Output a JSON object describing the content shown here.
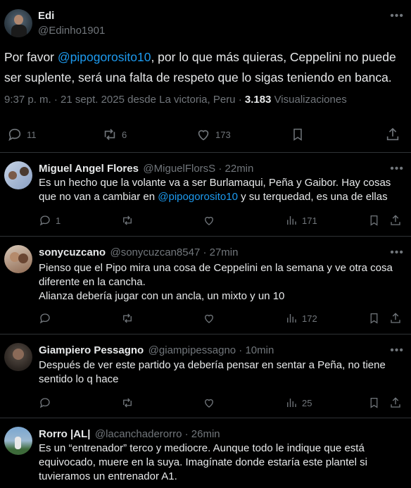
{
  "main": {
    "name": "Edi",
    "handle": "@Edinho1901",
    "text_pre": "Por favor ",
    "mention": "@pipogorosito10",
    "text_post": ", por lo que más quieras, Ceppelini no puede ser suplente, será una falta de respeto que lo sigas teniendo en banca.",
    "meta_time": "9:37 p. m. · 21 sept. 2025 desde La victoria, Peru · ",
    "views_count": "3.183",
    "views_label": " Visualizaciones",
    "replies": "11",
    "reposts": "6",
    "likes": "173"
  },
  "replies": [
    {
      "name": "Miguel Angel Flores",
      "handle": "@MiguelFlorsS · 22min",
      "text_pre": "Es un hecho que la volante va a  ser Burlamaqui, Peña y Gaibor. Hay cosas que no van a cambiar en ",
      "mention": "@pipogorosito10",
      "text_post": " y su terquedad, es una de ellas",
      "replies": "1",
      "views": "171"
    },
    {
      "name": "sonycuzcano",
      "handle": "@sonycuzcan8547 · 27min",
      "text_line1": "Pienso que el Pipo mira una cosa de Ceppelini en la semana y ve otra cosa diferente en la cancha.",
      "text_line2": "Alianza debería jugar con un ancla, un mixto y un 10",
      "views": "172"
    },
    {
      "name": "Giampiero Pessagno",
      "handle": "@giampipessagno · 10min",
      "text": "Después de ver este partido ya debería pensar en sentar a Peña, no tiene sentido lo q hace",
      "views": "25"
    },
    {
      "name": "Rorro |AL|",
      "handle": "@lacanchaderorro · 26min",
      "text": "Es un “entrenador” terco y mediocre. Aunque todo le indique que está equivocado, muere en la suya. Imagínate donde estaría este plantel si tuvieramos un entrenador A1."
    }
  ],
  "colors": {
    "accent": "#1d9bf0",
    "muted": "#71767b",
    "text": "#e7e9ea",
    "border": "#2f3336"
  },
  "icons": [
    "more-icon",
    "reply-icon",
    "repost-icon",
    "like-icon",
    "bookmark-icon",
    "share-icon",
    "views-icon"
  ]
}
